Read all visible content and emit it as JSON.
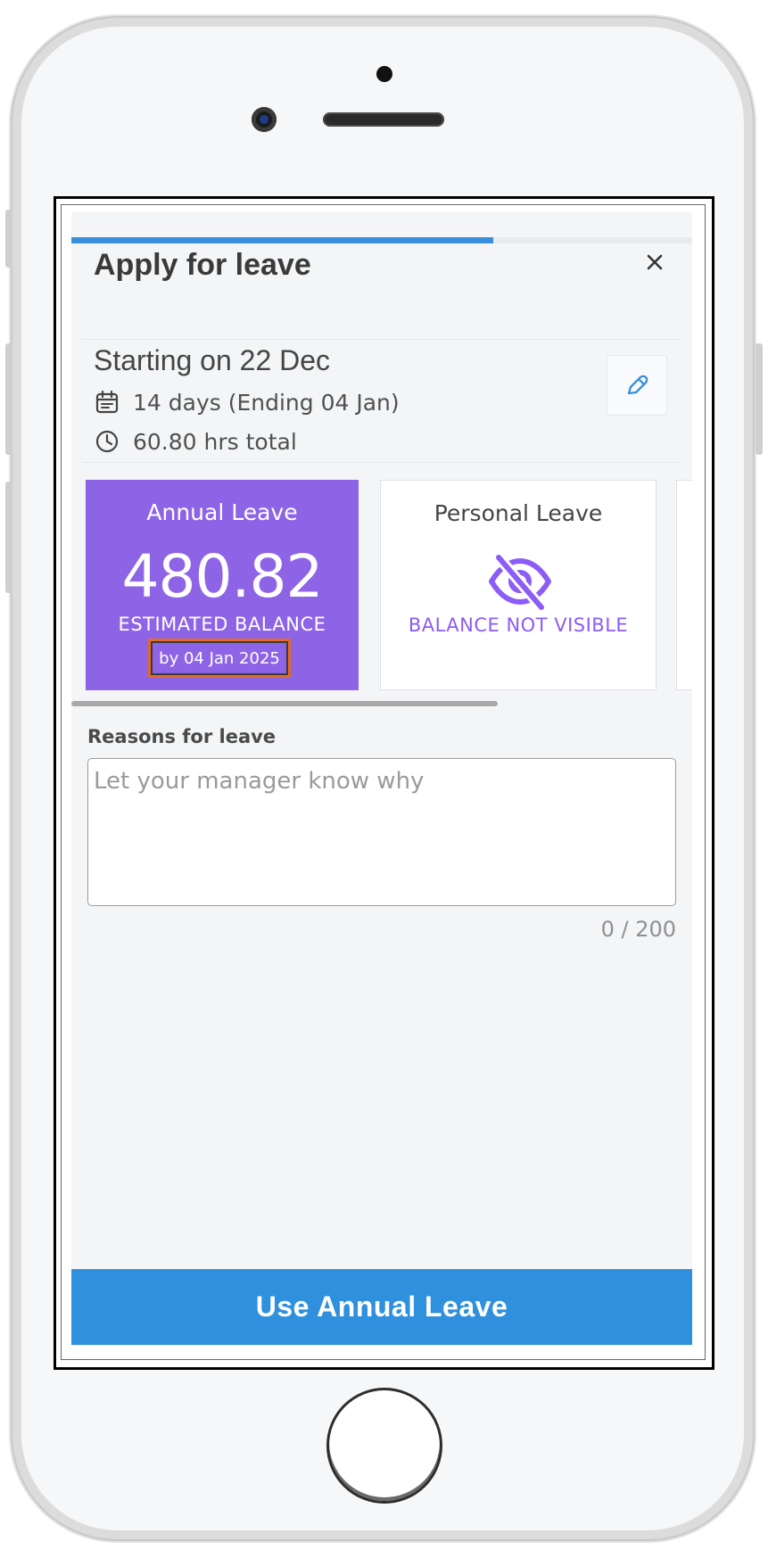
{
  "header": {
    "title": "Apply for leave",
    "close_icon": "close-icon",
    "progress_fraction": 0.68
  },
  "summary": {
    "starting": "Starting on 22 Dec",
    "duration": "14 days (Ending 04 Jan)",
    "hours": "60.80 hrs total",
    "calendar_icon": "calendar-icon",
    "clock_icon": "clock-icon",
    "edit_icon": "pencil-icon"
  },
  "cards": [
    {
      "name": "Annual Leave",
      "value": "480.82",
      "estimated_label": "ESTIMATED BALANCE",
      "by_date": "by 04 Jan 2025",
      "color": "#8e64e6",
      "selected": true
    },
    {
      "name": "Personal Leave",
      "hidden_label": "BALANCE NOT VISIBLE",
      "icon": "eye-off-icon",
      "color": "#8b5cf6"
    }
  ],
  "reasons": {
    "label": "Reasons for leave",
    "placeholder": "Let your manager know why",
    "counter": "0 / 200"
  },
  "footer": {
    "button_label": "Use Annual Leave",
    "color": "#2f90dd"
  }
}
